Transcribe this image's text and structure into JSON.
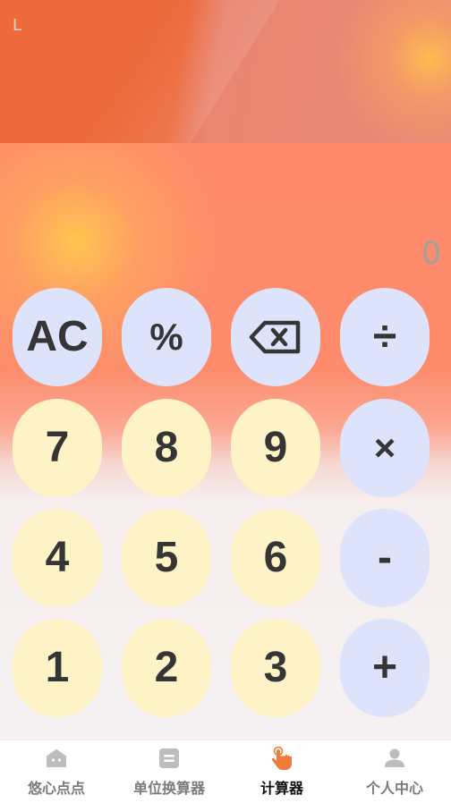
{
  "status": {
    "top_label": "L"
  },
  "display": {
    "value": "0"
  },
  "keys": {
    "ac": "AC",
    "percent": "%",
    "divide": "÷",
    "seven": "7",
    "eight": "8",
    "nine": "9",
    "multiply": "×",
    "four": "4",
    "five": "5",
    "six": "6",
    "minus": "-",
    "one": "1",
    "two": "2",
    "three": "3",
    "plus": "+"
  },
  "tabs": [
    {
      "label": "悠心点点",
      "icon": "home-icon"
    },
    {
      "label": "单位换算器",
      "icon": "converter-icon"
    },
    {
      "label": "计算器",
      "icon": "tap-hand-icon",
      "active": true
    },
    {
      "label": "个人中心",
      "icon": "person-icon"
    }
  ],
  "colors": {
    "operator_key": "#dce3fb",
    "number_key": "#fef3c7",
    "active_tab_icon": "#f07a3a",
    "inactive_tab_icon": "#bdbdbd"
  }
}
